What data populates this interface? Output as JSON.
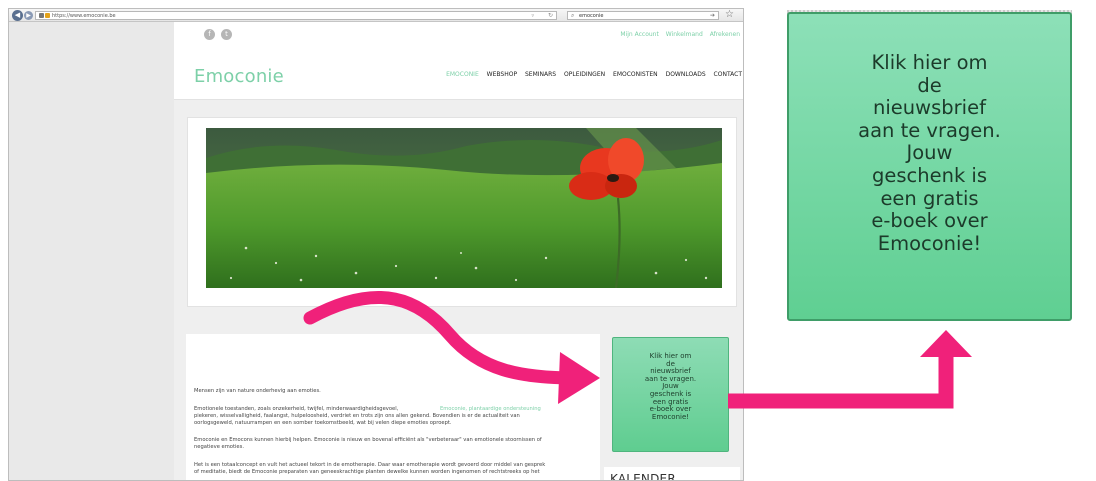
{
  "browser": {
    "url": "https://www.emoconie.be",
    "search_query": "emoconie",
    "back_icon": "back-arrow-icon",
    "star_icon": "bookmark-star-icon"
  },
  "site": {
    "logo": "Emoconie",
    "top_links": [
      "Mijn Account",
      "Winkelmand",
      "Afrekenen"
    ],
    "nav": [
      "EMOCONIE",
      "WEBSHOP",
      "SEMINARS",
      "OPLEIDINGEN",
      "EMOCONISTEN",
      "DOWNLOADS",
      "CONTACT"
    ],
    "accent": "#7dd0a8"
  },
  "article": {
    "p1": "Mensen zijn van nature onderhevig aan emoties.",
    "p2a": "Emotionele toestanden, zoals onzekerheid, twijfel, minderwaardigheidsgevoel,",
    "p2_highlight": "Emoconie, plantaardige ondersteuning",
    "p2b": "piekeren, wisselvalligheid, faalangst, hulpeloosheid, verdriet en trots zijn ons allen gekend. Bovendien is er de actualiteit van",
    "p2c": "oorlogsgeweld, natuurrampen en een somber toekomstbeeld, wat bij velen diepe emoties oproept.",
    "p3a": "Emoconie en Emocons kunnen hierbij helpen. Emoconie is nieuw en bovenal efficiënt als \"verbeteraar\" van emotionele stoornissen of",
    "p3b": "negatieve emoties.",
    "p4a": "Het is een totaalconcept en vult het actueel tekort in de emotherapie. Daar waar emotherapie wordt gevoerd door middel van gesprek",
    "p4b": "of meditatie, biedt de Emoconie preparaten van geneeskrachtige planten dewelke kunnen worden ingenomen of rechtstreeks op het"
  },
  "newsletter": {
    "lines": [
      "Klik hier om",
      "de",
      "nieuwsbrief",
      "aan te vragen.",
      "Jouw",
      "geschenk is",
      "een gratis",
      "e-boek over",
      "Emoconie!"
    ]
  },
  "sidebar": {
    "kalender": "KALENDER"
  },
  "colors": {
    "arrow": "#f0217a",
    "widget_green": "#6fd49e"
  }
}
